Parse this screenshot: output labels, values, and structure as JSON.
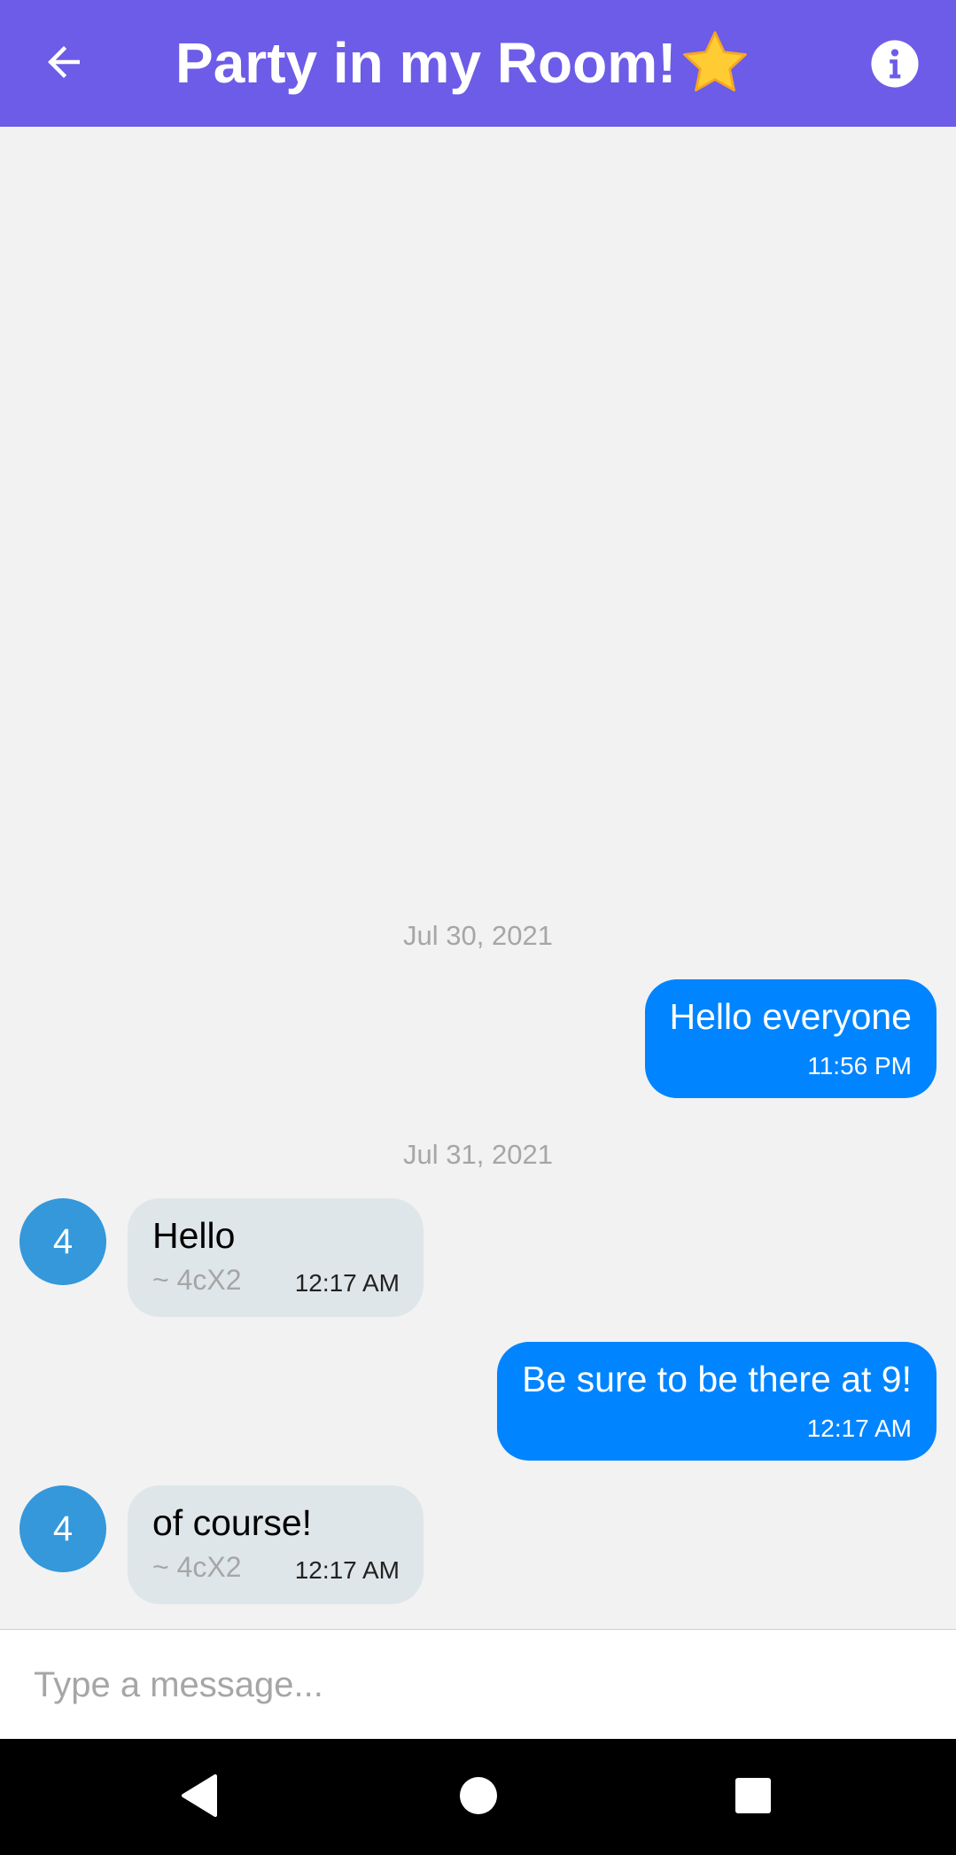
{
  "header": {
    "title": "Party in my Room!",
    "title_emoji": "star-icon",
    "back_icon": "arrow-left-icon",
    "info_icon": "info-icon"
  },
  "chat": {
    "date_separators": [
      "Jul 30, 2021",
      "Jul 31, 2021"
    ],
    "messages": [
      {
        "direction": "outgoing",
        "text": "Hello everyone",
        "time": "11:56 PM"
      },
      {
        "direction": "incoming",
        "avatar": "4",
        "text": "Hello",
        "sender": "~ 4cX2",
        "time": "12:17 AM"
      },
      {
        "direction": "outgoing",
        "text": "Be sure to be there at 9!",
        "time": "12:17 AM"
      },
      {
        "direction": "incoming",
        "avatar": "4",
        "text": "of course!",
        "sender": "~ 4cX2",
        "time": "12:17 AM"
      }
    ]
  },
  "composer": {
    "placeholder": "Type a message..."
  },
  "nav": {
    "back": "triangle-back-icon",
    "home": "circle-home-icon",
    "recents": "square-recents-icon"
  },
  "colors": {
    "header": "#6c5ce7",
    "outgoing_bubble": "#0084ff",
    "incoming_bubble": "#dfe6e9",
    "avatar": "#3498db",
    "background": "#f2f2f2"
  }
}
